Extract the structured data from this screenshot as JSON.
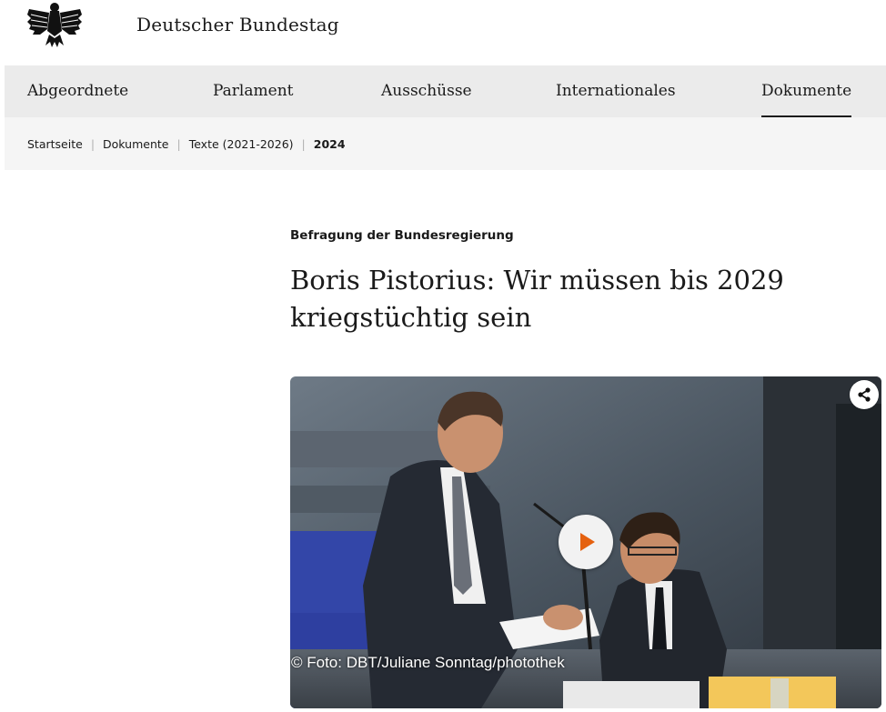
{
  "header": {
    "site_title": "Deutscher Bundestag",
    "logo_icon": "federal-eagle-icon"
  },
  "nav": {
    "items": [
      {
        "label": "Abgeordnete",
        "active": false
      },
      {
        "label": "Parlament",
        "active": false
      },
      {
        "label": "Ausschüsse",
        "active": false
      },
      {
        "label": "Internationales",
        "active": false
      },
      {
        "label": "Dokumente",
        "active": true
      }
    ]
  },
  "breadcrumb": {
    "items": [
      "Startseite",
      "Dokumente",
      "Texte (2021-2026)",
      "2024"
    ]
  },
  "article": {
    "kicker": "Befragung der Bundesregierung",
    "headline": "Boris Pistorius: Wir müssen bis 2029 kriegstüchtig sein"
  },
  "video": {
    "credit": "© Foto: DBT/Juliane Sonntag/photothek",
    "play_icon": "play-icon",
    "share_icon": "share-icon",
    "play_color": "#e5610f"
  }
}
